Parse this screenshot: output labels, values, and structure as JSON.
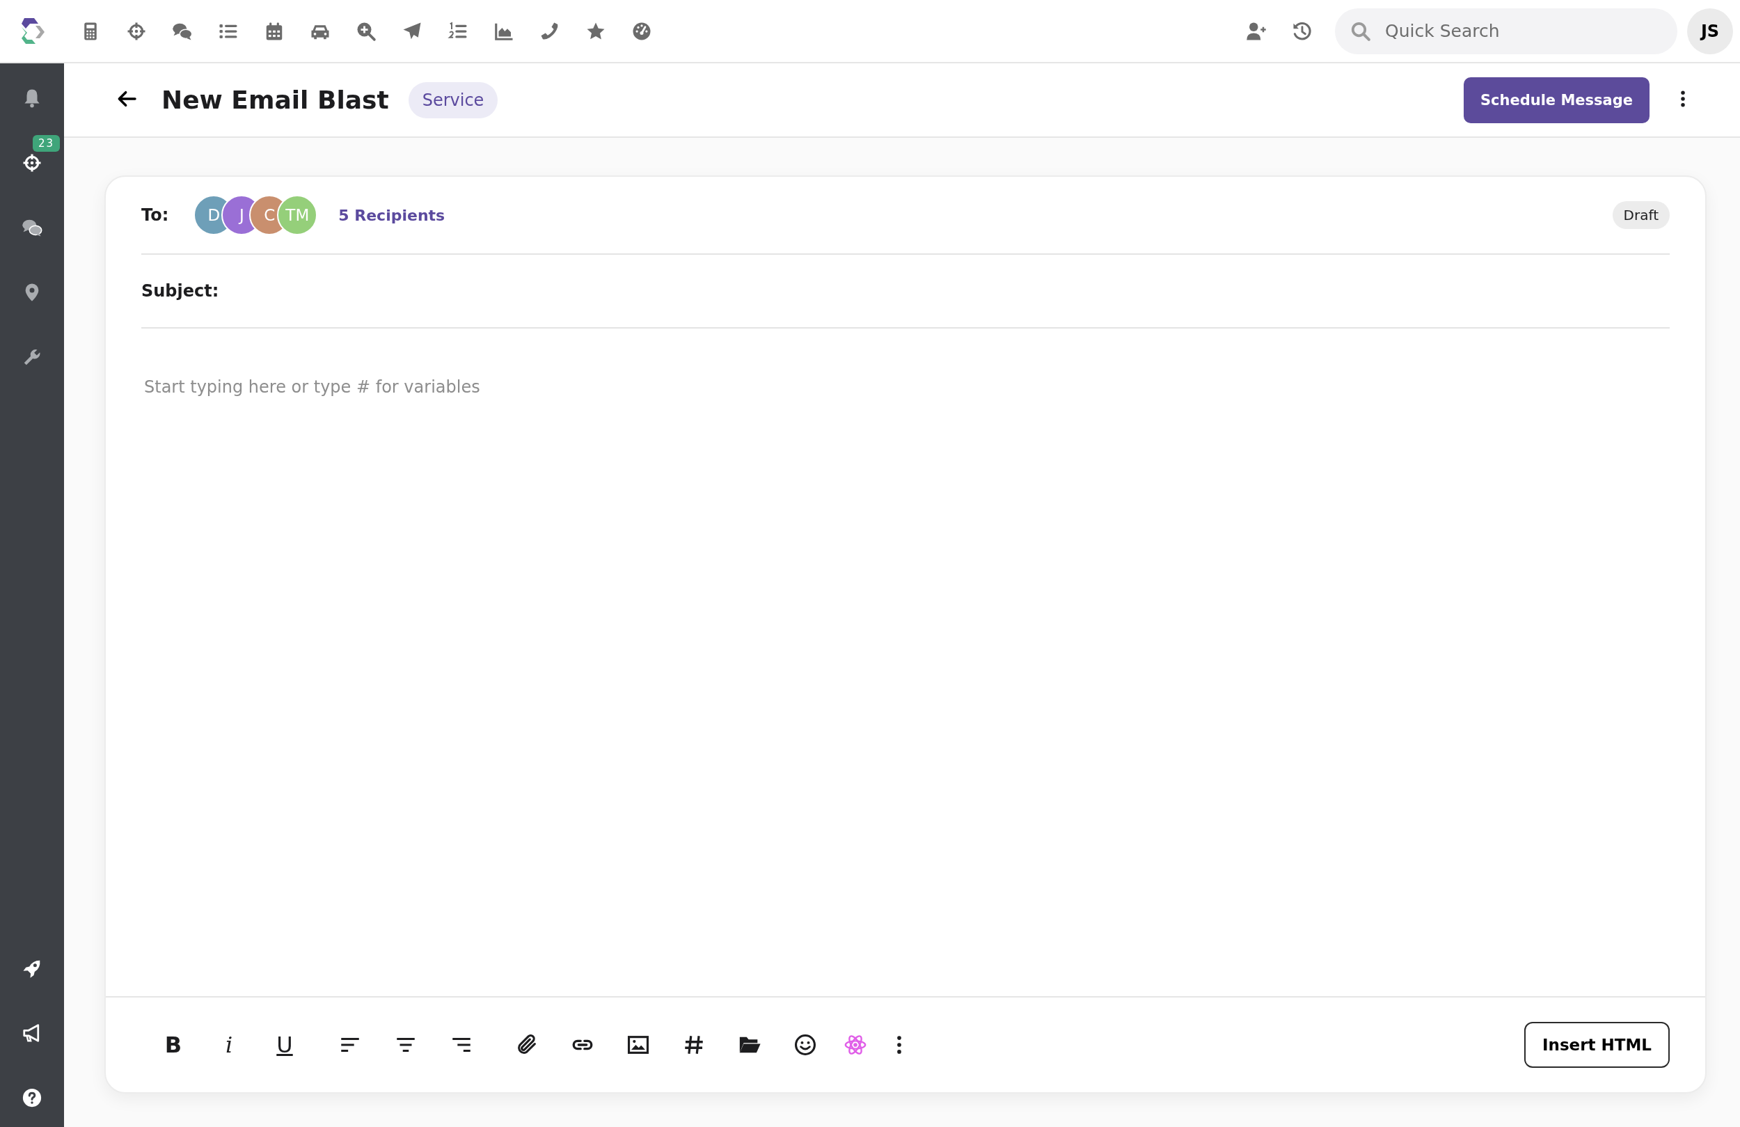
{
  "top_bar": {
    "search": {
      "placeholder": "Quick Search"
    },
    "user_initials": "JS"
  },
  "sidebar": {
    "badge": "23"
  },
  "header": {
    "title": "New Email Blast",
    "tag": "Service",
    "primary_button": "Schedule Message"
  },
  "composer": {
    "to_label": "To:",
    "recipients": [
      {
        "initials": "D",
        "color": "#6e9fb8"
      },
      {
        "initials": "J",
        "color": "#9a6fd6"
      },
      {
        "initials": "C",
        "color": "#c98f6e"
      },
      {
        "initials": "TM",
        "color": "#95cf7a"
      }
    ],
    "recipients_link": "5 Recipients",
    "status": "Draft",
    "subject_label": "Subject:",
    "body": {
      "placeholder": "Start typing here or type # for variables"
    },
    "format_buttons": [
      "B",
      "i",
      "U"
    ],
    "insert_button": "Insert HTML"
  }
}
